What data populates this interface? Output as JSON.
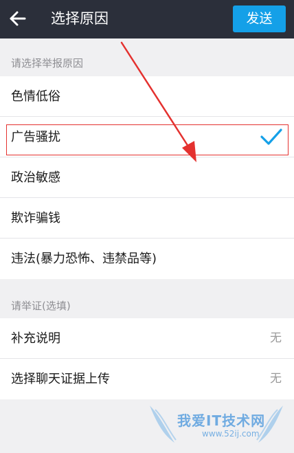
{
  "header": {
    "back_icon": "back-arrow-icon",
    "title": "选择原因",
    "send_label": "发送"
  },
  "reasons": {
    "section_label": "请选择举报原因",
    "items": [
      {
        "label": "色情低俗",
        "selected": false
      },
      {
        "label": "广告骚扰",
        "selected": true
      },
      {
        "label": "政治敏感",
        "selected": false
      },
      {
        "label": "欺诈骗钱",
        "selected": false
      },
      {
        "label": "违法(暴力恐怖、违禁品等)",
        "selected": false
      }
    ],
    "check_icon": "checkmark-icon"
  },
  "evidence": {
    "section_label": "请举证(选填)",
    "items": [
      {
        "label": "补充说明",
        "value": "无"
      },
      {
        "label": "选择聊天证据上传",
        "value": "无"
      }
    ]
  },
  "watermark": {
    "title": "我爱IT技术网",
    "url": "www.52ij.com"
  },
  "colors": {
    "header_bg": "#2b2f3a",
    "accent": "#14a0e8",
    "annotation_red": "#e4312f",
    "page_bg": "#f0f0f2"
  }
}
